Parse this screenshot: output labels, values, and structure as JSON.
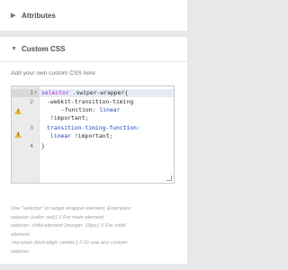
{
  "attributes_section": {
    "title": "Attributes",
    "caret": "▶"
  },
  "custom_css_section": {
    "title": "Custom CSS",
    "caret": "▼",
    "description": "Add your own custom CSS here",
    "editor": {
      "lines": [
        {
          "number": "1",
          "warning": false,
          "fold": "▾",
          "parts": [
            "selector",
            " .swiper-wrapper{"
          ]
        },
        {
          "number": "2",
          "warning": true,
          "text_a": "-webkit-transition-timing",
          "text_b": "-function: ",
          "text_b_value": "linear",
          "text_c": "!important;"
        },
        {
          "number": "3",
          "warning": true,
          "text_a": "transition-timing-function:",
          "text_b_value": "linear",
          "text_b": " !important;"
        },
        {
          "number": "4",
          "warning": false,
          "text": "}"
        }
      ]
    },
    "help_lines": [
      "Use \"selector\" to target wrapper element. Examples:",
      "selector {color: red;} // For main element",
      "selector .child-element {margin: 10px;} // For child",
      "element",
      ".my-class {text-align: center;} // Or use any custom",
      "selector"
    ]
  },
  "colors": {
    "background": "#e6e8ea",
    "panel": "#ffffff",
    "warning": "#e8b53b",
    "keyword": "#9f1dce",
    "value": "#2142b5"
  }
}
